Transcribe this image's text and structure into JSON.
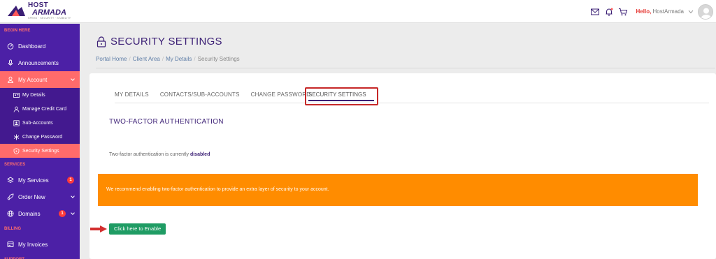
{
  "header": {
    "logo": {
      "line1": "HOST",
      "line2": "ARMADA",
      "tagline": "SPEED · SECURITY · STABILITY"
    },
    "greeting_prefix": "Hello, ",
    "greeting_name": "HostArmada",
    "icons": [
      "mail-icon",
      "bell-icon",
      "cart-icon",
      "chevron-down-icon",
      "avatar"
    ]
  },
  "sidebar": {
    "sections": [
      {
        "label": "BEGIN HERE"
      },
      {
        "label": "SERVICES"
      },
      {
        "label": "BILLING"
      },
      {
        "label": "SUPPORT"
      }
    ],
    "items": {
      "dashboard": "Dashboard",
      "announcements": "Announcements",
      "my_account": "My Account",
      "my_details": "My Details",
      "manage_credit_card": "Manage Credit Card",
      "sub_accounts": "Sub-Accounts",
      "change_password": "Change Password",
      "security_settings": "Security Settings",
      "my_services": "My Services",
      "my_services_badge": "1",
      "order_new": "Order New",
      "domains": "Domains",
      "domains_badge": "1",
      "my_invoices": "My Invoices"
    }
  },
  "main": {
    "title": "SECURITY SETTINGS",
    "breadcrumb": [
      "Portal Home",
      "Client Area",
      "My Details",
      "Security Settings"
    ],
    "tabs": [
      "MY DETAILS",
      "CONTACTS/SUB-ACCOUNTS",
      "CHANGE PASSWORD",
      "SECURITY SETTINGS"
    ],
    "section_title": "TWO-FACTOR AUTHENTICATION",
    "status_text": "Two-factor authentication is currently ",
    "status_value": "disabled",
    "alert_text": "We recommend enabling two-factor authentication to provide an extra layer of security to your account.",
    "enable_button": "Click here to Enable"
  },
  "colors": {
    "sidebar_bg": "#4c20a6",
    "active_item": "#ff6b6b",
    "alert_bg": "#ff8c00",
    "button_bg": "#1f9c64",
    "highlight_box": "#c62828",
    "title_color": "#3b1f75"
  }
}
